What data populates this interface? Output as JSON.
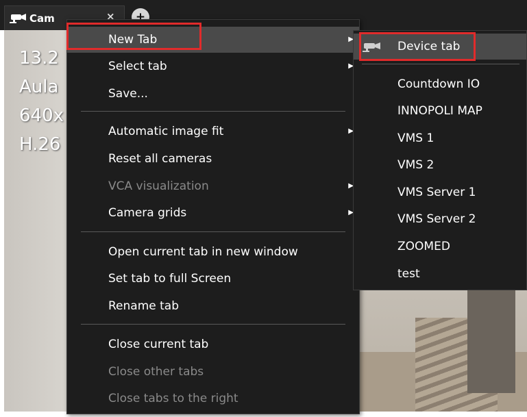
{
  "tab": {
    "label": "Cam",
    "close_glyph": "×",
    "add_glyph": "+",
    "icon": "camera-icon"
  },
  "overlay": {
    "line1": "13.2",
    "line2": "Aula",
    "line3": "640x",
    "line4": "H.26"
  },
  "context_menu": {
    "items": [
      {
        "label": "New Tab",
        "submenu": true,
        "enabled": true,
        "highlighted": true
      },
      {
        "label": "Select tab",
        "submenu": true,
        "enabled": true
      },
      {
        "label": "Save...",
        "submenu": false,
        "enabled": true
      },
      {
        "label": "Automatic image fit",
        "submenu": true,
        "enabled": true
      },
      {
        "label": "Reset all cameras",
        "submenu": false,
        "enabled": true
      },
      {
        "label": "VCA visualization",
        "submenu": true,
        "enabled": false
      },
      {
        "label": "Camera grids",
        "submenu": true,
        "enabled": true
      },
      {
        "label": "Open current tab in new window",
        "submenu": false,
        "enabled": true
      },
      {
        "label": "Set tab to full Screen",
        "submenu": false,
        "enabled": true
      },
      {
        "label": "Rename tab",
        "submenu": false,
        "enabled": true
      },
      {
        "label": "Close current tab",
        "submenu": false,
        "enabled": true
      },
      {
        "label": "Close other tabs",
        "submenu": false,
        "enabled": false
      },
      {
        "label": "Close tabs to the right",
        "submenu": false,
        "enabled": false
      }
    ],
    "arrow_glyph": "▶"
  },
  "submenu": {
    "items": [
      {
        "label": "Device tab",
        "icon": "camera-icon",
        "highlighted": true
      },
      {
        "label": "Countdown IO"
      },
      {
        "label": "INNOPOLI MAP"
      },
      {
        "label": "VMS 1"
      },
      {
        "label": "VMS 2"
      },
      {
        "label": "VMS Server 1"
      },
      {
        "label": "VMS Server 2"
      },
      {
        "label": "ZOOMED"
      },
      {
        "label": "test"
      }
    ]
  },
  "colors": {
    "menu_bg": "#1d1d1d",
    "hover_bg": "#4a4a4a",
    "highlight_box": "#e12b2b",
    "disabled_text": "#8a8a8a"
  }
}
